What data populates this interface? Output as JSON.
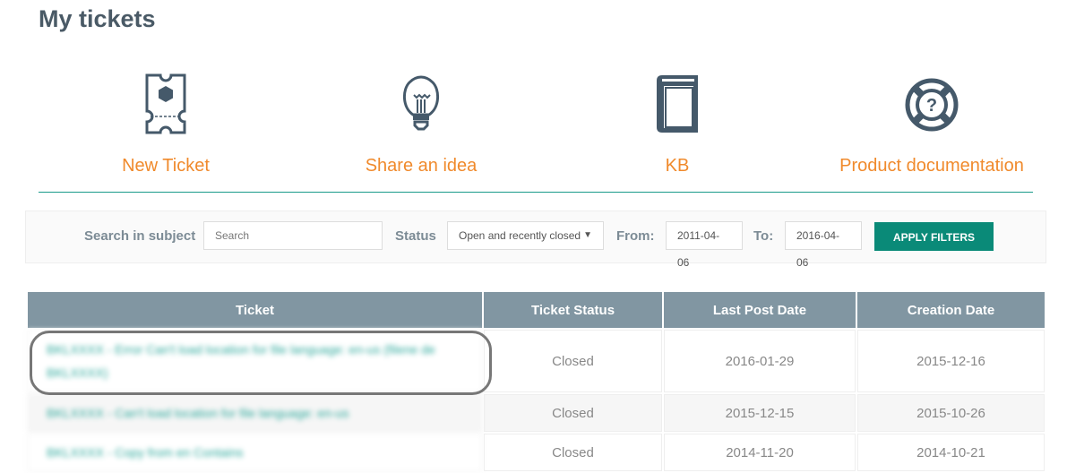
{
  "page": {
    "title": "My tickets"
  },
  "quicklinks": [
    {
      "label": "New Ticket",
      "icon": "ticket-icon"
    },
    {
      "label": "Share an idea",
      "icon": "lightbulb-icon"
    },
    {
      "label": "KB",
      "icon": "book-icon"
    },
    {
      "label": "Product documentation",
      "icon": "lifebuoy-icon"
    }
  ],
  "filters": {
    "search_label": "Search in subject",
    "search_placeholder": "Search",
    "search_value": "",
    "status_label": "Status",
    "status_value": "Open and recently closed",
    "from_label": "From:",
    "from_value": "2011-04-06",
    "to_label": "To:",
    "to_value": "2016-04-06",
    "apply_label": "APPLY FILTERS"
  },
  "table": {
    "headers": [
      "Ticket",
      "Ticket Status",
      "Last Post Date",
      "Creation Date"
    ],
    "rows": [
      {
        "ticket": "BKLXXXX - Error Can't load location for file language: en-us (filene de BKLXXXX)",
        "status": "Closed",
        "last_post": "2016-01-29",
        "created": "2015-12-16"
      },
      {
        "ticket": "BKLXXXX - Can't load location for file language: en-us",
        "status": "Closed",
        "last_post": "2015-12-15",
        "created": "2015-10-26"
      },
      {
        "ticket": "BKLXXXX - Copy from en Contains",
        "status": "Closed",
        "last_post": "2014-11-20",
        "created": "2014-10-21"
      }
    ]
  }
}
